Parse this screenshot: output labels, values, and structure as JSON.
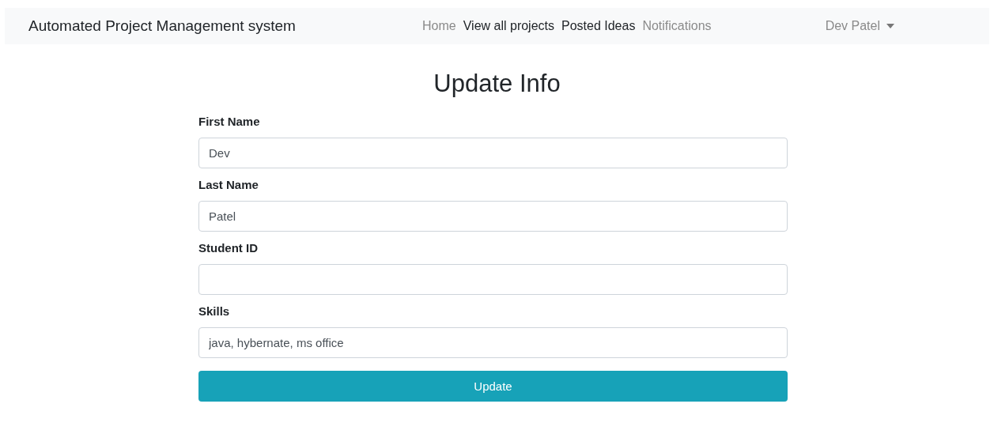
{
  "navbar": {
    "brand": "Automated Project Management system",
    "links": [
      {
        "label": "Home",
        "active": false
      },
      {
        "label": "View all projects",
        "active": true
      },
      {
        "label": "Posted Ideas",
        "active": true
      },
      {
        "label": "Notifications",
        "active": false
      }
    ],
    "user_menu": {
      "label": "Dev Patel"
    }
  },
  "form": {
    "title": "Update Info",
    "fields": [
      {
        "label": "First Name",
        "value": "Dev"
      },
      {
        "label": "Last Name",
        "value": "Patel"
      },
      {
        "label": "Student ID"
      },
      {
        "label": "Skills",
        "value": "java, hybernate, ms office"
      }
    ],
    "submit": "Update"
  }
}
